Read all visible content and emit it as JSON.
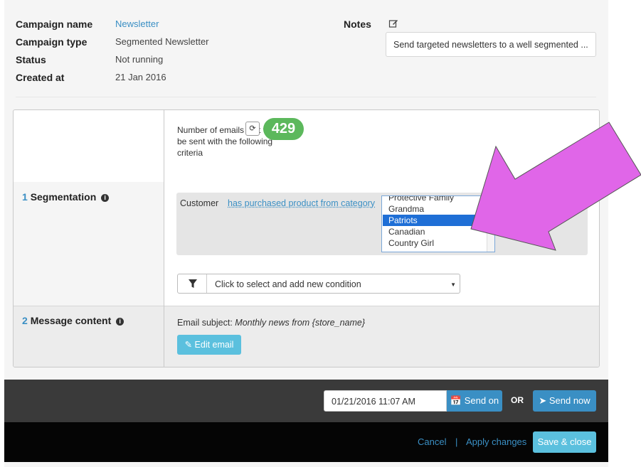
{
  "campaign": {
    "name_label": "Campaign name",
    "name_value": "Newsletter",
    "type_label": "Campaign type",
    "type_value": "Segmented Newsletter",
    "status_label": "Status",
    "status_value": "Not running",
    "created_label": "Created at",
    "created_value": "21 Jan 2016",
    "notes_label": "Notes",
    "notes_value": "Send targeted newsletters to a well segmented ..."
  },
  "count": {
    "description": "Number of emails that will be sent with the following criteria",
    "value": "429",
    "refresh_icon": "refresh-icon"
  },
  "segmentation": {
    "number": "1",
    "title": "Segmentation",
    "condition": {
      "subject": "Customer",
      "operator": "has purchased product from category",
      "options": [
        "Protective Family",
        "Grandma",
        "Patriots",
        "Canadian",
        "Country Girl"
      ],
      "selected": "Patriots"
    },
    "add_condition_placeholder": "Click to select and add new condition"
  },
  "message": {
    "number": "2",
    "title": "Message content",
    "subject_label": "Email subject:",
    "subject_value": "Monthly news from {store_name}",
    "edit_label": "Edit email"
  },
  "send": {
    "datetime": "01/21/2016 11:07 AM",
    "send_on_label": "Send on",
    "or_label": "OR",
    "send_now_label": "Send now"
  },
  "footer": {
    "cancel_label": "Cancel",
    "separator": "|",
    "apply_label": "Apply changes",
    "save_close_label": "Save & close"
  },
  "colors": {
    "accent": "#3a8fc4",
    "badge": "#5cb85c",
    "info_button": "#5bc0de",
    "annotation_arrow": "#e066e8"
  }
}
